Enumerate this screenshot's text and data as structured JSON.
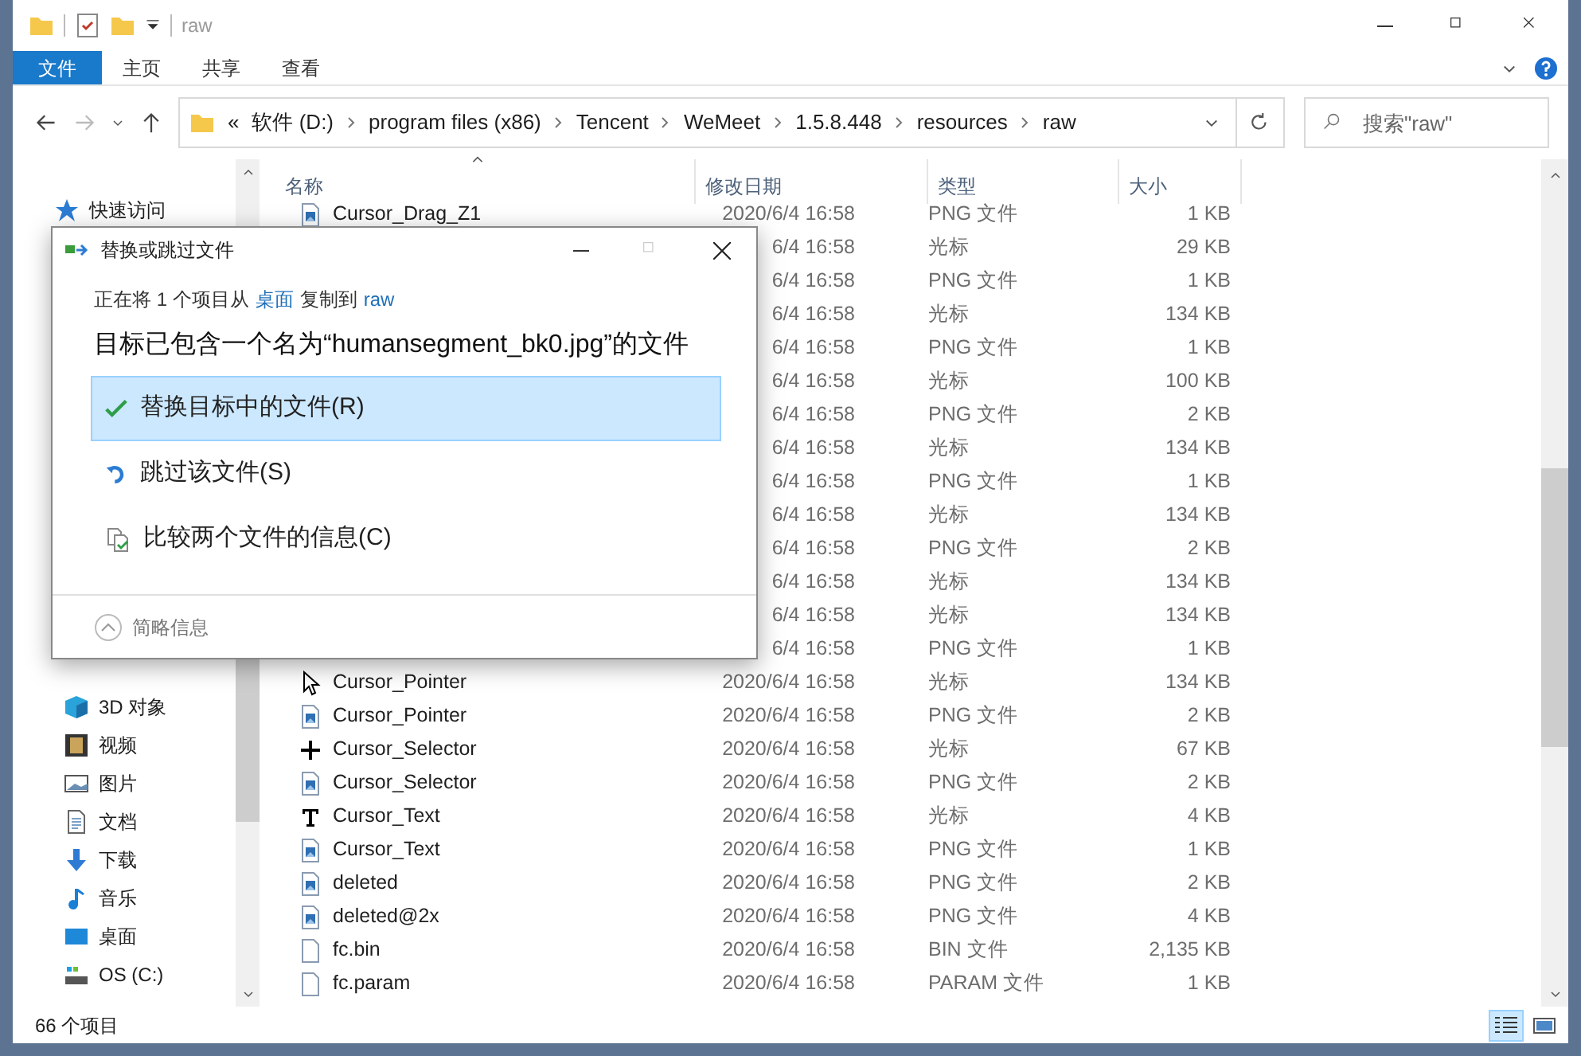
{
  "window": {
    "title": "raw"
  },
  "ribbon_tabs": [
    {
      "label": "文件",
      "kind": "file-menu"
    },
    {
      "label": "主页",
      "kind": "tab"
    },
    {
      "label": "共享",
      "kind": "tab"
    },
    {
      "label": "查看",
      "kind": "tab"
    }
  ],
  "address_bar": {
    "overflow": "«",
    "crumbs": [
      "软件 (D:)",
      "program files (x86)",
      "Tencent",
      "WeMeet",
      "1.5.8.448",
      "resources",
      "raw"
    ]
  },
  "search": {
    "placeholder": "搜索\"raw\""
  },
  "columns": [
    {
      "label": "名称",
      "sorted": true
    },
    {
      "label": "修改日期",
      "sorted": false
    },
    {
      "label": "类型",
      "sorted": false
    },
    {
      "label": "大小",
      "sorted": false
    }
  ],
  "sidebar": {
    "quick_access": [
      {
        "label": "快速访问",
        "kind": "star"
      }
    ],
    "this_pc": [
      {
        "label": "3D 对象",
        "kind": "cube"
      },
      {
        "label": "视频",
        "kind": "film"
      },
      {
        "label": "图片",
        "kind": "image"
      },
      {
        "label": "文档",
        "kind": "document"
      },
      {
        "label": "下载",
        "kind": "download"
      },
      {
        "label": "音乐",
        "kind": "music"
      },
      {
        "label": "桌面",
        "kind": "desktop"
      },
      {
        "label": "OS (C:)",
        "kind": "drive"
      }
    ]
  },
  "rows": [
    {
      "name": "Cursor_Drag_Z1",
      "kind": "image",
      "date": "2020/6/4 16:58",
      "type": "PNG 文件",
      "size": "1 KB"
    },
    {
      "date": "6/4 16:58",
      "type": "光标",
      "size": "29 KB"
    },
    {
      "date": "6/4 16:58",
      "type": "PNG 文件",
      "size": "1 KB"
    },
    {
      "date": "6/4 16:58",
      "type": "光标",
      "size": "134 KB"
    },
    {
      "date": "6/4 16:58",
      "type": "PNG 文件",
      "size": "1 KB"
    },
    {
      "date": "6/4 16:58",
      "type": "光标",
      "size": "100 KB"
    },
    {
      "date": "6/4 16:58",
      "type": "PNG 文件",
      "size": "2 KB"
    },
    {
      "date": "6/4 16:58",
      "type": "光标",
      "size": "134 KB"
    },
    {
      "date": "6/4 16:58",
      "type": "PNG 文件",
      "size": "1 KB"
    },
    {
      "date": "6/4 16:58",
      "type": "光标",
      "size": "134 KB"
    },
    {
      "date": "6/4 16:58",
      "type": "PNG 文件",
      "size": "2 KB"
    },
    {
      "date": "6/4 16:58",
      "type": "光标",
      "size": "134 KB"
    },
    {
      "date": "6/4 16:58",
      "type": "光标",
      "size": "134 KB"
    },
    {
      "date": "6/4 16:58",
      "type": "PNG 文件",
      "size": "1 KB"
    },
    {
      "name": "Cursor_Pointer",
      "kind": "cursor",
      "date": "2020/6/4 16:58",
      "type": "光标",
      "size": "134 KB"
    },
    {
      "name": "Cursor_Pointer",
      "kind": "image",
      "date": "2020/6/4 16:58",
      "type": "PNG 文件",
      "size": "2 KB"
    },
    {
      "name": "Cursor_Selector",
      "kind": "crosshair",
      "date": "2020/6/4 16:58",
      "type": "光标",
      "size": "67 KB"
    },
    {
      "name": "Cursor_Selector",
      "kind": "image",
      "date": "2020/6/4 16:58",
      "type": "PNG 文件",
      "size": "2 KB"
    },
    {
      "name": "Cursor_Text",
      "kind": "text-cursor",
      "date": "2020/6/4 16:58",
      "type": "光标",
      "size": "4 KB"
    },
    {
      "name": "Cursor_Text",
      "kind": "image",
      "date": "2020/6/4 16:58",
      "type": "PNG 文件",
      "size": "1 KB"
    },
    {
      "name": "deleted",
      "kind": "image",
      "date": "2020/6/4 16:58",
      "type": "PNG 文件",
      "size": "2 KB"
    },
    {
      "name": "deleted@2x",
      "kind": "image",
      "date": "2020/6/4 16:58",
      "type": "PNG 文件",
      "size": "4 KB"
    },
    {
      "name": "fc.bin",
      "kind": "file",
      "date": "2020/6/4 16:58",
      "type": "BIN 文件",
      "size": "2,135 KB"
    },
    {
      "name": "fc.param",
      "kind": "file",
      "date": "2020/6/4 16:58",
      "type": "PARAM 文件",
      "size": "1 KB"
    }
  ],
  "status_bar": {
    "count": "66 个项目"
  },
  "view_buttons": [
    {
      "kind": "details",
      "selected": true
    },
    {
      "kind": "thumbnails",
      "selected": false
    }
  ],
  "dialog": {
    "title": "替换或跳过文件",
    "copy_line": [
      {
        "text": "正在将 1 个项目从",
        "link": false
      },
      {
        "text": "桌面",
        "link": true
      },
      {
        "text": "复制到",
        "link": false
      },
      {
        "text": "raw",
        "link": true
      }
    ],
    "heading": "目标已包含一个名为“humansegment_bk0.jpg”的文件",
    "options": [
      {
        "label": "替换目标中的文件(R)",
        "kind": "check",
        "selected": true
      },
      {
        "label": "跳过该文件(S)",
        "kind": "skip",
        "selected": false
      },
      {
        "label": "比较两个文件的信息(C)",
        "kind": "compare",
        "selected": false
      }
    ],
    "details_toggle": "简略信息"
  }
}
